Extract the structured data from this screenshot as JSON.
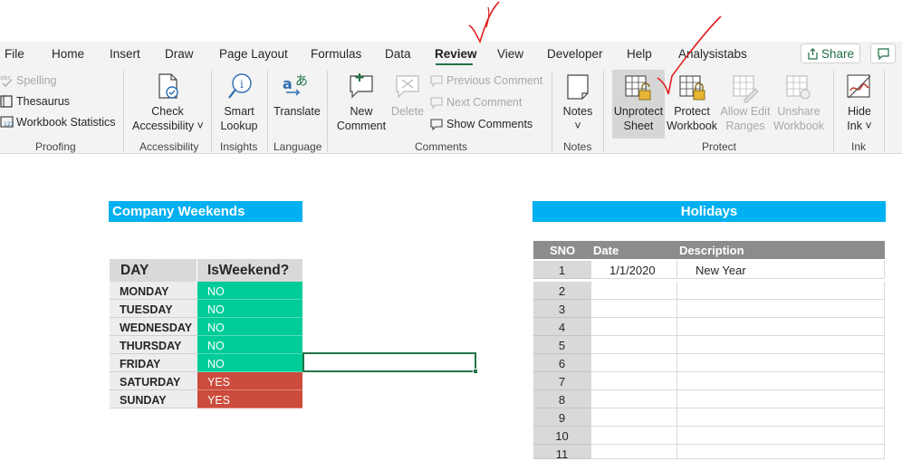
{
  "menu": {
    "items": [
      "File",
      "Home",
      "Insert",
      "Draw",
      "Page Layout",
      "Formulas",
      "Data",
      "Review",
      "View",
      "Developer",
      "Help",
      "Analysistabs"
    ],
    "active": "Review",
    "share_label": "Share"
  },
  "ribbon": {
    "proofing": {
      "spelling": "Spelling",
      "thesaurus": "Thesaurus",
      "workbook_statistics": "Workbook Statistics",
      "label": "Proofing"
    },
    "accessibility": {
      "check_line1": "Check",
      "check_line2": "Accessibility",
      "label": "Accessibility"
    },
    "insights": {
      "smart_line1": "Smart",
      "smart_line2": "Lookup",
      "label": "Insights"
    },
    "language": {
      "translate": "Translate",
      "label": "Language"
    },
    "comments": {
      "new_line1": "New",
      "new_line2": "Comment",
      "delete": "Delete",
      "previous": "Previous Comment",
      "next": "Next Comment",
      "show": "Show Comments",
      "label": "Comments"
    },
    "notes": {
      "notes": "Notes",
      "label": "Notes"
    },
    "protect": {
      "unprotect_line1": "Unprotect",
      "unprotect_line2": "Sheet",
      "protect_wb_line1": "Protect",
      "protect_wb_line2": "Workbook",
      "allow_line1": "Allow Edit",
      "allow_line2": "Ranges",
      "unshare_line1": "Unshare",
      "unshare_line2": "Workbook",
      "label": "Protect"
    },
    "ink": {
      "hide_line1": "Hide",
      "hide_line2": "Ink",
      "label": "Ink"
    }
  },
  "sheet": {
    "weekends_title": "Company Weekends",
    "weekends_headers": {
      "day": "DAY",
      "isweekend": "IsWeekend?"
    },
    "weekends_rows": [
      {
        "day": "MONDAY",
        "value": "NO"
      },
      {
        "day": "TUESDAY",
        "value": "NO"
      },
      {
        "day": "WEDNESDAY",
        "value": "NO"
      },
      {
        "day": "THURSDAY",
        "value": "NO"
      },
      {
        "day": "FRIDAY",
        "value": "NO"
      },
      {
        "day": "SATURDAY",
        "value": "YES"
      },
      {
        "day": "SUNDAY",
        "value": "YES"
      }
    ],
    "holidays_title": "Holidays",
    "holidays_headers": {
      "sno": "SNO",
      "date": "Date",
      "description": "Description"
    },
    "holidays_rows": [
      {
        "sno": "1",
        "date": "1/1/2020",
        "description": "New Year"
      },
      {
        "sno": "2",
        "date": "",
        "description": ""
      },
      {
        "sno": "3",
        "date": "",
        "description": ""
      },
      {
        "sno": "4",
        "date": "",
        "description": ""
      },
      {
        "sno": "5",
        "date": "",
        "description": ""
      },
      {
        "sno": "6",
        "date": "",
        "description": ""
      },
      {
        "sno": "7",
        "date": "",
        "description": ""
      },
      {
        "sno": "8",
        "date": "",
        "description": ""
      },
      {
        "sno": "9",
        "date": "",
        "description": ""
      },
      {
        "sno": "10",
        "date": "",
        "description": ""
      },
      {
        "sno": "11",
        "date": "",
        "description": ""
      }
    ]
  },
  "colors": {
    "green": "#00cc99",
    "red": "#cc4b3c",
    "blue": "#00b0f0",
    "excel_green": "#217346",
    "annotation_red": "#e02020"
  }
}
